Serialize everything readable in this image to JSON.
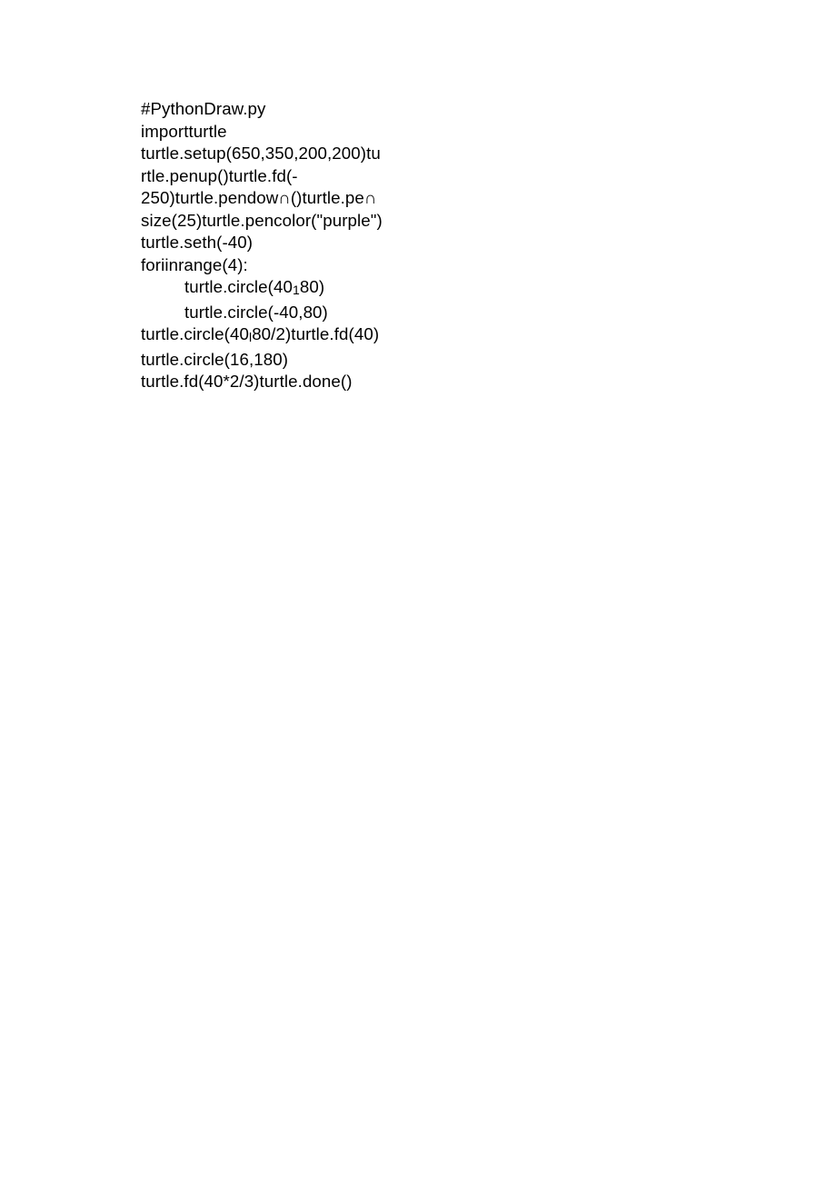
{
  "code": {
    "line1": "#PythonDraw.py",
    "line2": "importturtle",
    "line3a": "turtle.setup(650,350,200,200)tu",
    "line3b": "rtle.penup()turtle.fd(-",
    "line3c": "250)turtle.pendow∩()turtle.pe∩",
    "line3d": "size(25)turtle.pencolor(\"purple\")",
    "line4": "turtle.seth(-40)",
    "line5": "foriinrange(4):",
    "line6a_pre": "turtle.circle(40",
    "line6a_sub": "1",
    "line6a_post": "80)",
    "line6b": "turtle.circle(-40,80)",
    "line7_pre": "turtle.circle(40",
    "line7_sub": "l",
    "line7_post": "80/2)turtle.fd(40)",
    "line8": "turtle.circle(16,180)",
    "line9": "turtle.fd(40*2/3)turtle.done()"
  }
}
